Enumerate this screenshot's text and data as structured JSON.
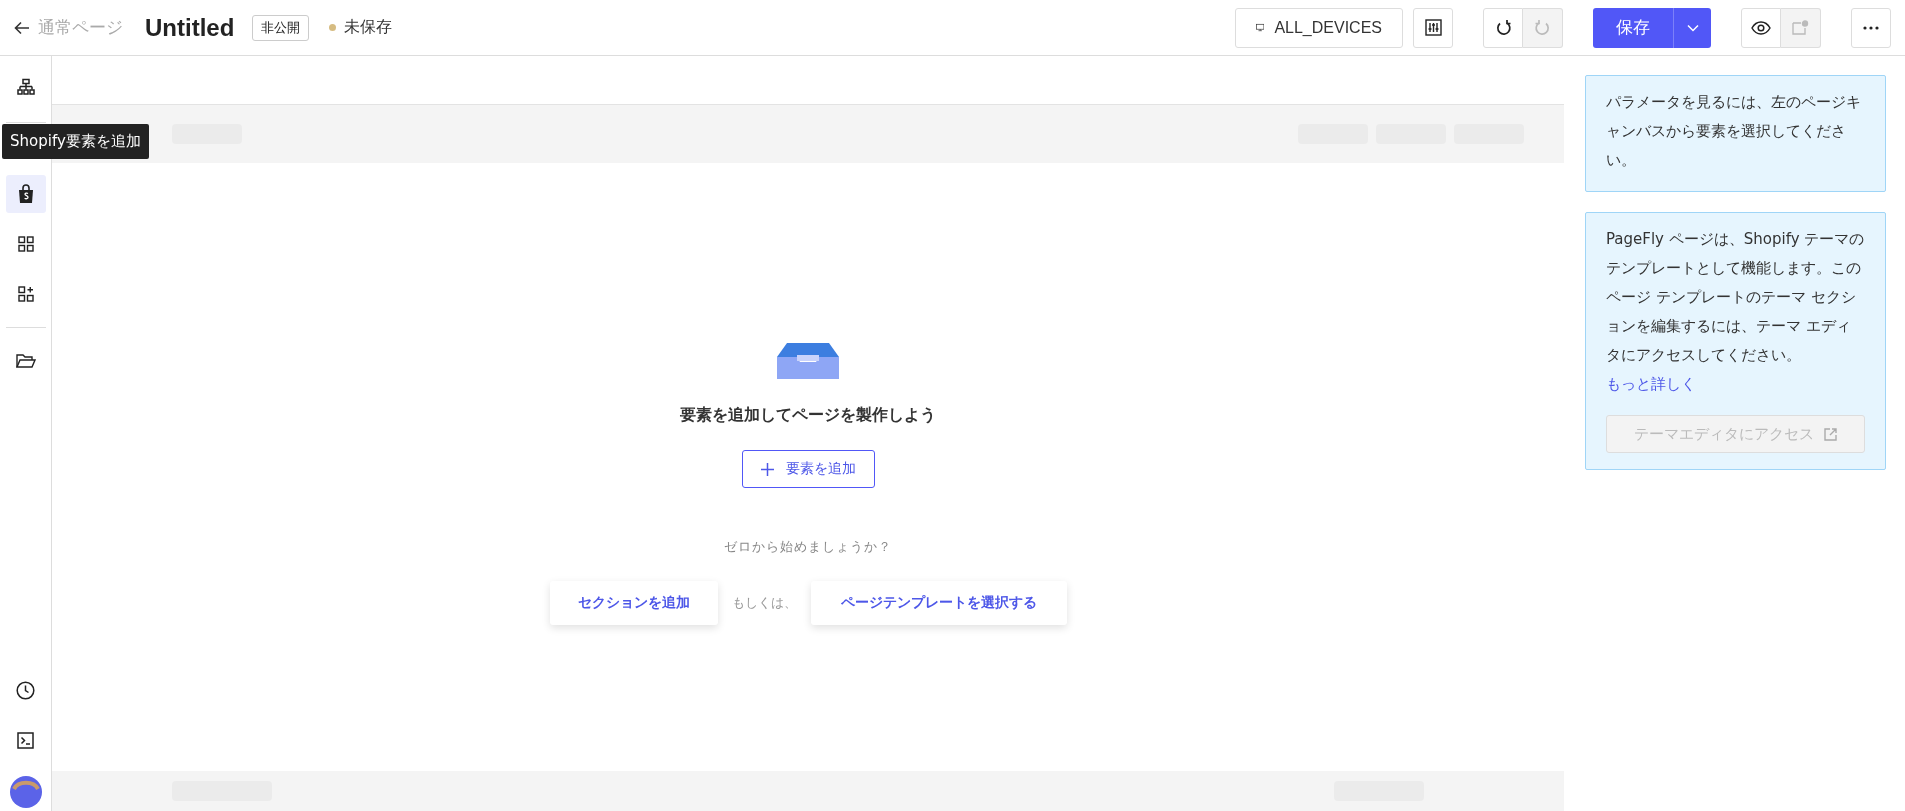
{
  "header": {
    "back_label": "通常ページ",
    "title": "Untitled",
    "visibility_badge": "非公開",
    "save_state": "未保存",
    "device_button": "ALL_DEVICES",
    "save_button": "保存",
    "redo_disabled": true
  },
  "sidebar": {
    "top_items": [
      {
        "kind": "sitemap",
        "selected": false
      },
      {
        "kind": "shopify",
        "selected": true
      },
      {
        "kind": "grid",
        "selected": false
      },
      {
        "kind": "grid-plus",
        "selected": false
      }
    ],
    "middle_items": [
      {
        "kind": "folder",
        "selected": false
      }
    ],
    "bottom_items": [
      {
        "kind": "clock",
        "selected": false
      },
      {
        "kind": "terminal",
        "selected": false
      }
    ],
    "tooltip": "Shopify要素を追加"
  },
  "canvas": {
    "heading": "要素を追加してページを製作しよう",
    "add_button": "要素を追加",
    "prompt": "ゼロから始めましょうか？",
    "section_button": "セクションを追加",
    "or_label": "もしくは、",
    "template_button": "ページテンプレートを選択する"
  },
  "inspector": {
    "hint": "パラメータを見るには、左のページキャンバスから要素を選択してください。",
    "info": "PageFly ページは、Shopify テーマのテンプレートとして機能します。このページ テンプレートのテーマ セクションを編集するには、テーマ エディタにアクセスしてください。",
    "learn_more_link": "もっと詳しく",
    "theme_editor_button": "テーマエディタにアクセス",
    "theme_editor_disabled": true
  }
}
